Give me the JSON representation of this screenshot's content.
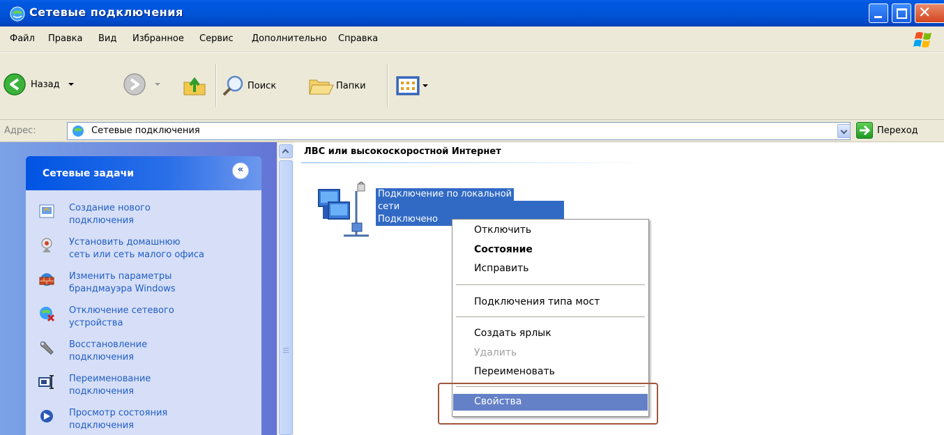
{
  "window": {
    "title": "Сетевые подключения",
    "icon": "network-connections-icon"
  },
  "menubar": {
    "items": [
      "Файл",
      "Правка",
      "Вид",
      "Избранное",
      "Сервис",
      "Дополнительно",
      "Справка"
    ]
  },
  "toolbar": {
    "back_label": "Назад",
    "search_label": "Поиск",
    "folders_label": "Папки"
  },
  "address": {
    "label": "Адрес:",
    "value": "Сетевые подключения",
    "go_label": "Переход"
  },
  "tasks": {
    "title": "Сетевые задачи",
    "items": [
      {
        "line1": "Создание нового",
        "line2": "подключения",
        "icon": "new-connection-icon"
      },
      {
        "line1": "Установить домашнюю",
        "line2": "сеть или сеть малого офиса",
        "icon": "home-network-icon"
      },
      {
        "line1": "Изменить параметры",
        "line2": "брандмауэра Windows",
        "icon": "firewall-icon"
      },
      {
        "line1": "Отключение сетевого",
        "line2": "устройства",
        "icon": "disable-device-icon"
      },
      {
        "line1": "Восстановление",
        "line2": "подключения",
        "icon": "repair-icon"
      },
      {
        "line1": "Переименование",
        "line2": "подключения",
        "icon": "rename-icon"
      },
      {
        "line1": "Просмотр состояния",
        "line2": "подключения",
        "icon": "status-icon"
      }
    ]
  },
  "content": {
    "group_header": "ЛВС или высокоскоростной Интернет",
    "connection": {
      "name_line1": "Подключение по локальной",
      "name_line2": "сети",
      "status_partial": "Подключено"
    }
  },
  "context_menu": {
    "items": {
      "disconnect": "Отключить",
      "status": "Состояние",
      "repair": "Исправить",
      "bridge": "Подключения типа мост",
      "shortcut": "Создать ярлык",
      "delete": "Удалить",
      "rename": "Переименовать",
      "properties": "Свойства"
    }
  },
  "colors": {
    "titlebar": "#0054d8",
    "selection": "#316ac5",
    "menu_highlight": "#6481c8",
    "task_link": "#215dc6",
    "annotation_frame": "#a0573a"
  }
}
